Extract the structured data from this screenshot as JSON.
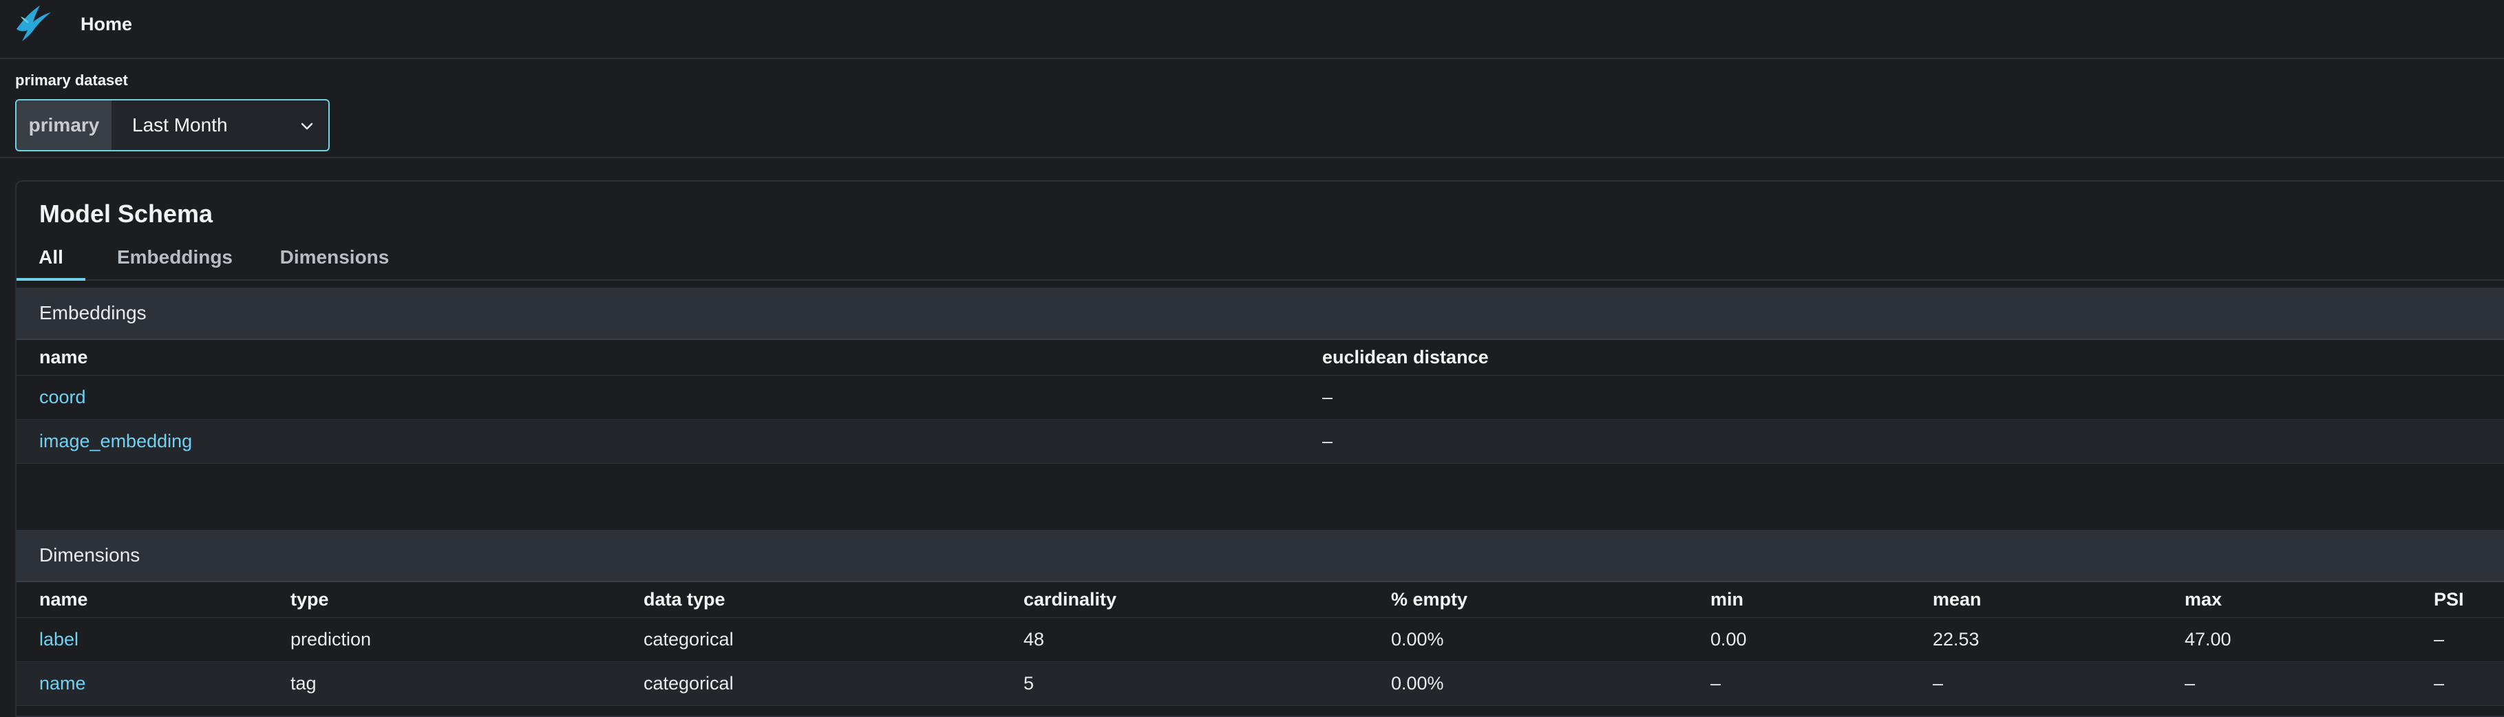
{
  "header": {
    "title": "Home",
    "logo": "bird-logo-icon"
  },
  "dataset": {
    "label": "primary dataset",
    "addon": "primary",
    "selected": "Last Month"
  },
  "panel": {
    "title": "Model Schema",
    "tabs": [
      "All",
      "Embeddings",
      "Dimensions"
    ],
    "active_tab": "All"
  },
  "embeddings": {
    "title": "Embeddings",
    "columns": [
      "name",
      "euclidean distance"
    ],
    "rows": [
      {
        "name": "coord",
        "euclidean_distance": "–"
      },
      {
        "name": "image_embedding",
        "euclidean_distance": "–"
      }
    ]
  },
  "dimensions": {
    "title": "Dimensions",
    "columns": [
      "name",
      "type",
      "data type",
      "cardinality",
      "% empty",
      "min",
      "mean",
      "max",
      "PSI"
    ],
    "rows": [
      {
        "name": "label",
        "type": "prediction",
        "data_type": "categorical",
        "cardinality": "48",
        "empty": "0.00%",
        "min": "0.00",
        "mean": "22.53",
        "max": "47.00",
        "psi": "–"
      },
      {
        "name": "name",
        "type": "tag",
        "data_type": "categorical",
        "cardinality": "5",
        "empty": "0.00%",
        "min": "–",
        "mean": "–",
        "max": "–",
        "psi": "–"
      }
    ]
  },
  "colors": {
    "accent": "#6fd1e6",
    "link": "#6fd1f2",
    "background": "#1b1d21",
    "section": "#2d3138"
  }
}
